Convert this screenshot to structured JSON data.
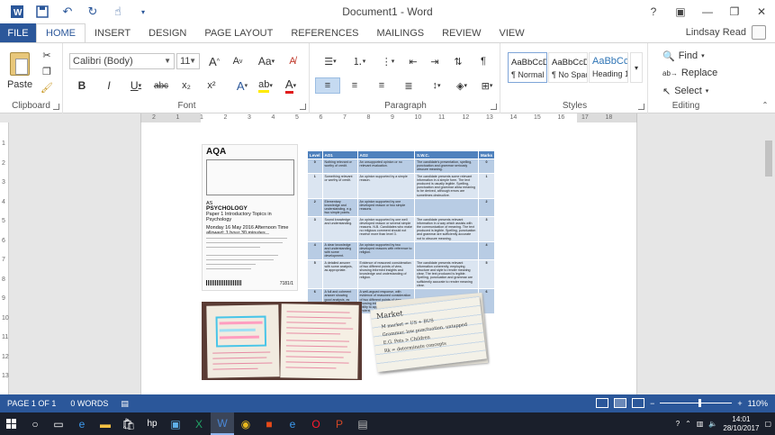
{
  "titlebar": {
    "title": "Document1 - Word",
    "help": "?",
    "min": "—",
    "restore": "❐",
    "close": "✕"
  },
  "tabs": [
    "FILE",
    "HOME",
    "INSERT",
    "DESIGN",
    "PAGE LAYOUT",
    "REFERENCES",
    "MAILINGS",
    "REVIEW",
    "VIEW"
  ],
  "user": {
    "name": "Lindsay Read"
  },
  "ribbon": {
    "clipboard": {
      "label": "Clipboard",
      "paste": "Paste"
    },
    "font": {
      "label": "Font",
      "font_name": "Calibri (Body)",
      "font_size": "11",
      "bold": "B",
      "italic": "I",
      "underline": "U",
      "strike": "abc",
      "subscript": "x₂",
      "superscript": "x²",
      "grow": "A",
      "shrink": "A",
      "change_case": "Aa"
    },
    "paragraph": {
      "label": "Paragraph"
    },
    "styles": {
      "label": "Styles",
      "items": [
        {
          "sample": "AaBbCcDc",
          "name": "¶ Normal"
        },
        {
          "sample": "AaBbCcDc",
          "name": "¶ No Spac..."
        },
        {
          "sample": "AaBbCc",
          "name": "Heading 1"
        }
      ]
    },
    "editing": {
      "label": "Editing",
      "find": "Find",
      "replace": "Replace",
      "select": "Select"
    }
  },
  "ruler": {
    "ticks": [
      "2",
      "1",
      "1",
      "2",
      "3",
      "4",
      "5",
      "6",
      "7",
      "8",
      "9",
      "10",
      "11",
      "12",
      "13",
      "14",
      "15",
      "16",
      "17",
      "18"
    ]
  },
  "vruler": {
    "ticks": [
      "1",
      "2",
      "3",
      "4",
      "5",
      "6",
      "7",
      "8",
      "9",
      "10",
      "11",
      "12",
      "13"
    ]
  },
  "document": {
    "exam": {
      "logo": "AQA",
      "level": "AS",
      "subject": "PSYCHOLOGY",
      "paper": "Paper 1 Introductory Topics in Psychology",
      "date": "Monday 16 May 2016   Afternoon   Time allowed: 1 hour 30 minutes",
      "code": "7181/1"
    },
    "markscheme": {
      "headers": [
        "Level",
        "AO1",
        "AO2",
        "S.W.C.",
        "Marks"
      ],
      "rows": [
        [
          "0",
          "Nothing relevant or worthy of credit.",
          "An unsupported opinion or no relevant evaluation.",
          "The candidate's presentation, spelling, punctuation and grammar seriously obscure meaning.",
          "0"
        ],
        [
          "1",
          "Something relevant or worthy of credit.",
          "An opinion supported by a simple reason.",
          "The candidate presents some relevant information in a simple form. The text produced is usually legible. Spelling, punctuation and grammar allow meaning to be derived, although errors are sometimes obstructive.",
          "1"
        ],
        [
          "2",
          "Elementary knowledge and understanding, e.g. two simple points.",
          "An opinion supported by one developed reason or two simple reasons.",
          "",
          "2"
        ],
        [
          "3",
          "Sound knowledge and understanding.",
          "An opinion supported by one well developed reason or several simple reasons. N.B. Candidates who make no religious comment should not receive more than level 3.",
          "The candidate presents relevant information in a way which assists with the communication of meaning. The text produced is legible. Spelling, punctuation and grammar are sufficiently accurate not to obscure meaning.",
          "3"
        ],
        [
          "4",
          "A clear knowledge and understanding with some development.",
          "An opinion supported by two developed reasons with reference to religion.",
          "",
          "4"
        ],
        [
          "5",
          "A detailed answer with some analysis, as appropriate.",
          "Evidence of reasoned consideration of two different points of view, showing informed insights and knowledge and understanding of religion.",
          "The candidate presents relevant information coherently, employing structure and style to render meaning clear. The text produced is legible. Spelling, punctuation and grammar are sufficiently accurate to render meaning clear.",
          "5"
        ],
        [
          "6",
          "A full and coherent answer showing good analysis, as appropriate.",
          "A well-argued response, with evidence of reasoned consideration of two different points of view showing informed insights and ability to apply knowledge and understanding of religion effectively.",
          "",
          "6"
        ]
      ]
    },
    "card": {
      "title": "Market",
      "items": [
        "M market = US + BUS",
        "Grammar, low punctuation, untapped",
        "E.G. Pets > Children",
        "Rk = determinate concepts"
      ]
    }
  },
  "statusbar": {
    "page": "PAGE 1 OF 1",
    "words": "0 WORDS",
    "zoom_pct": "110%",
    "zoom_level": 0.55
  },
  "taskbar": {
    "time": "14:01",
    "date": "28/10/2017",
    "icons": [
      "windows-start-icon",
      "search-icon",
      "task-view-icon",
      "edge-icon",
      "file-explorer-icon",
      "store-icon",
      "hp-icon",
      "photos-icon",
      "excel-icon",
      "word-icon",
      "chrome-icon",
      "app-icon",
      "ie-icon",
      "opera-icon",
      "powerpoint-icon",
      "app2-icon"
    ]
  }
}
